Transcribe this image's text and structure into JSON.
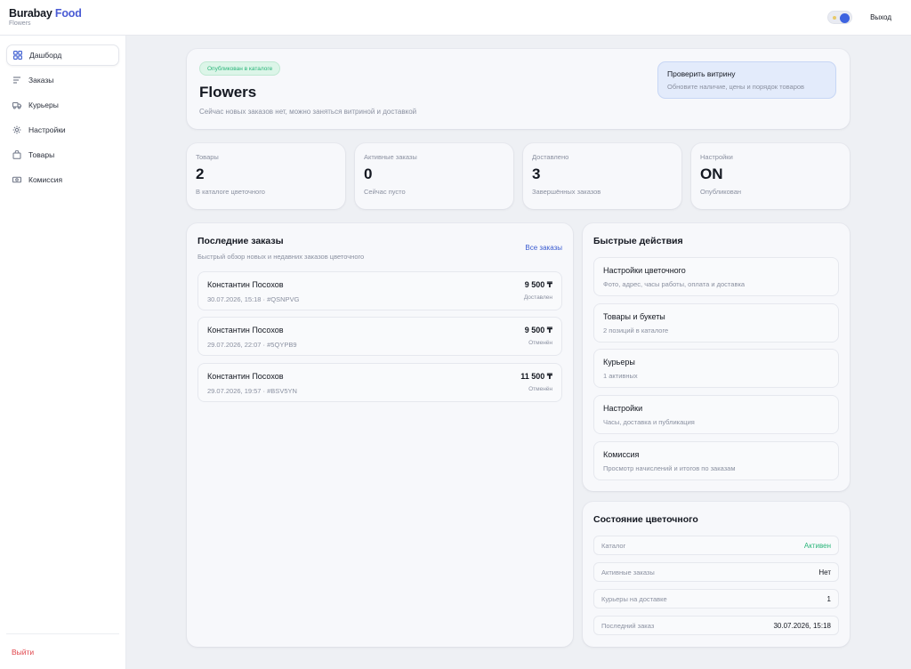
{
  "brand": {
    "name_part1": "Burabay",
    "name_part2": "Food",
    "subtitle": "Flowers"
  },
  "topbar": {
    "logout_label": "Выход"
  },
  "sidebar": {
    "items": [
      {
        "label": "Дашборд",
        "icon": "grid-icon",
        "active": true
      },
      {
        "label": "Заказы",
        "icon": "list-icon"
      },
      {
        "label": "Курьеры",
        "icon": "truck-icon"
      },
      {
        "label": "Настройки",
        "icon": "gear-icon"
      },
      {
        "label": "Товары",
        "icon": "bag-icon"
      },
      {
        "label": "Комиссия",
        "icon": "cash-icon"
      }
    ],
    "exit_label": "Выйти"
  },
  "hero": {
    "badge": "Опубликован в каталоге",
    "title": "Flowers",
    "subtitle": "Сейчас новых заказов нет, можно заняться витриной и доставкой",
    "action_title": "Проверить витрину",
    "action_subtitle": "Обновите наличие, цены и порядок товаров"
  },
  "stats": [
    {
      "label": "Товары",
      "value": "2",
      "note": "В каталоге цветочного"
    },
    {
      "label": "Активные заказы",
      "value": "0",
      "note": "Сейчас пусто"
    },
    {
      "label": "Доставлено",
      "value": "3",
      "note": "Завершённых заказов"
    },
    {
      "label": "Настройки",
      "value": "ON",
      "note": "Опубликован"
    }
  ],
  "orders": {
    "title": "Последние заказы",
    "subtitle": "Быстрый обзор новых и недавних заказов цветочного",
    "all_link": "Все заказы",
    "items": [
      {
        "name": "Константин Посохов",
        "meta": "30.07.2026, 15:18 · #QSNPVG",
        "sum": "9 500 ₸",
        "status": "Доставлен"
      },
      {
        "name": "Константин Посохов",
        "meta": "29.07.2026, 22:07 · #5QYPB9",
        "sum": "9 500 ₸",
        "status": "Отменён"
      },
      {
        "name": "Константин Посохов",
        "meta": "29.07.2026, 19:57 · #BSV5YN",
        "sum": "11 500 ₸",
        "status": "Отменён"
      }
    ]
  },
  "quick_actions": {
    "title": "Быстрые действия",
    "items": [
      {
        "title": "Настройки цветочного",
        "subtitle": "Фото, адрес, часы работы, оплата и доставка"
      },
      {
        "title": "Товары и букеты",
        "subtitle": "2 позиций в каталоге"
      },
      {
        "title": "Курьеры",
        "subtitle": "1 активных"
      },
      {
        "title": "Настройки",
        "subtitle": "Часы, доставка и публикация"
      },
      {
        "title": "Комиссия",
        "subtitle": "Просмотр начислений и итогов по заказам"
      }
    ]
  },
  "state": {
    "title": "Состояние цветочного",
    "rows": [
      {
        "label": "Каталог",
        "value": "Активен"
      },
      {
        "label": "Активные заказы",
        "value": "Нет"
      },
      {
        "label": "Курьеры на доставке",
        "value": "1"
      },
      {
        "label": "Последний заказ",
        "value": "30.07.2026, 15:18"
      }
    ]
  },
  "colors": {
    "accent": "#3a5bd0",
    "success": "#2bb57a",
    "danger": "#e0454b"
  }
}
